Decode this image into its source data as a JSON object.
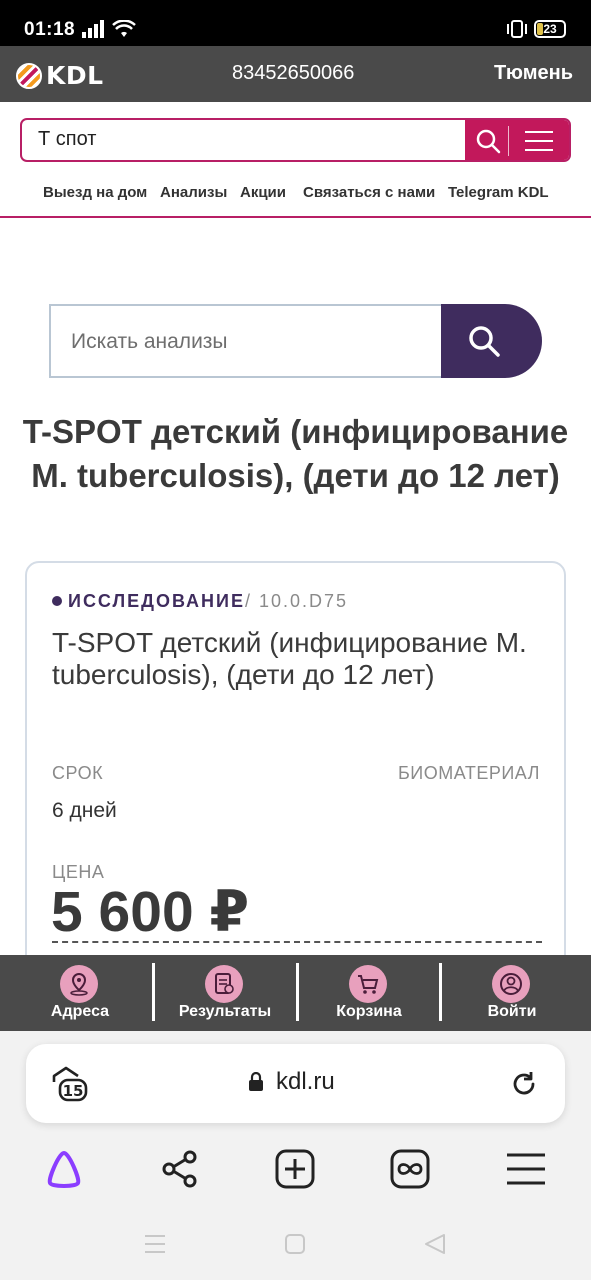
{
  "status_bar": {
    "time": "01:18",
    "battery": "23"
  },
  "header": {
    "logo_text": "KDL",
    "phone": "83452650066",
    "city": "Тюмень"
  },
  "site_search": {
    "value": "Т спот"
  },
  "nav": {
    "items": [
      "Выезд на дом",
      "Анализы",
      "Акции",
      "Связаться с нами",
      "Telegram KDL"
    ]
  },
  "analysis_search": {
    "placeholder": "Искать анализы"
  },
  "page": {
    "title": "T-SPOT детский (инфицирование M. tuberculosis), (дети до 12 лет)"
  },
  "card": {
    "kind": "ИССЛЕДОВАНИЕ",
    "code": "/ 10.0.D75",
    "name": "T-SPOT детский (инфицирование M. tuberculosis), (дети до 12 лет)",
    "term_label": "СРОК",
    "biomaterial_label": "БИОМАТЕРИАЛ",
    "term_value": "6 дней",
    "price_label": "ЦЕНА",
    "price": "5 600 ₽"
  },
  "bottom_nav": {
    "items": [
      "Адреса",
      "Результаты",
      "Корзина",
      "Войти"
    ]
  },
  "browser": {
    "url": "kdl.ru",
    "tab_count": "15"
  },
  "colors": {
    "brand": "#c2185b",
    "dark_purple": "#3f2c5e",
    "bar": "#4a4a4a"
  }
}
